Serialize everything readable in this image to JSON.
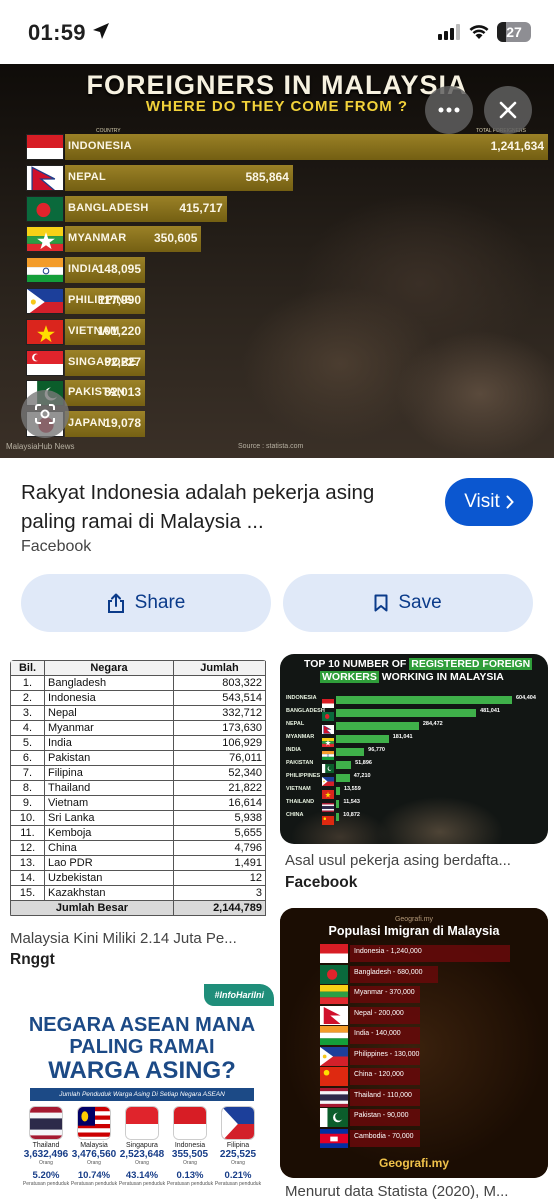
{
  "status_bar": {
    "time": "01:59",
    "battery": "27"
  },
  "hero": {
    "title": "FOREIGNERS IN MALAYSIA",
    "subtitle": "WHERE DO THEY COME FROM ?",
    "col_country": "COUNTRY",
    "col_total": "TOTAL FOREIGNERS",
    "footer": "MalaysiaHub News",
    "source": "Source : statista.com",
    "chart_data": {
      "type": "bar",
      "title": "FOREIGNERS IN MALAYSIA",
      "subtitle": "WHERE DO THEY COME FROM ?",
      "categories": [
        "INDONESIA",
        "NEPAL",
        "BANGLADESH",
        "MYANMAR",
        "INDIA",
        "PHILIPPINE",
        "VIETNAM",
        "SINGAPORE",
        "PAKISTAN",
        "JAPAN"
      ],
      "values": [
        1241634,
        585864,
        415717,
        350605,
        148095,
        117990,
        101220,
        92227,
        82013,
        19078
      ],
      "labels": [
        "1,241,634",
        "585,864",
        "415,717",
        "350,605",
        "148,095",
        "117,990",
        "101,220",
        "92,227",
        "82,013",
        "19,078"
      ],
      "orientation": "horizontal"
    }
  },
  "result": {
    "title": "Rakyat Indonesia adalah pekerja asing paling ramai di Malaysia ...",
    "source": "Facebook",
    "visit_label": "Visit",
    "share_label": "Share",
    "save_label": "Save"
  },
  "cards": {
    "table_card": {
      "headers": [
        "Bil.",
        "Negara",
        "Jumlah"
      ],
      "rows": [
        [
          "1.",
          "Bangladesh",
          "803,322"
        ],
        [
          "2.",
          "Indonesia",
          "543,514"
        ],
        [
          "3.",
          "Nepal",
          "332,712"
        ],
        [
          "4.",
          "Myanmar",
          "173,630"
        ],
        [
          "5.",
          "India",
          "106,929"
        ],
        [
          "6.",
          "Pakistan",
          "76,011"
        ],
        [
          "7.",
          "Filipina",
          "52,340"
        ],
        [
          "8.",
          "Thailand",
          "21,822"
        ],
        [
          "9.",
          "Vietnam",
          "16,614"
        ],
        [
          "10.",
          "Sri Lanka",
          "5,938"
        ],
        [
          "11.",
          "Kemboja",
          "5,655"
        ],
        [
          "12.",
          "China",
          "4,796"
        ],
        [
          "13.",
          "Lao PDR",
          "1,491"
        ],
        [
          "14.",
          "Uzbekistan",
          "12"
        ],
        [
          "15.",
          "Kazakhstan",
          "3"
        ]
      ],
      "total_label": "Jumlah Besar",
      "total_value": "2,144,789",
      "caption": "Malaysia Kini Miliki 2.14 Juta Pe...",
      "source": "Rnggt"
    },
    "top10_card": {
      "title_a": "TOP 10 NUMBER OF",
      "title_b": "REGISTERED FOREIGN",
      "title_c": "WORKERS",
      "title_d": "WORKING IN MALAYSIA",
      "chart_data": {
        "type": "bar",
        "categories": [
          "INDONESIA",
          "BANGLADESH",
          "NEPAL",
          "MYANMAR",
          "INDIA",
          "PAKISTAN",
          "PHILIPPINES",
          "VIETNAM",
          "THAILAND",
          "CHINA"
        ],
        "values": [
          604404,
          481041,
          284472,
          181041,
          96770,
          51896,
          47210,
          13559,
          11543,
          10872
        ],
        "labels": [
          "604,404",
          "481,041",
          "284,472",
          "181,041",
          "96,770",
          "51,896",
          "47,210",
          "13,559",
          "11,543",
          "10,872"
        ]
      },
      "caption": "Asal usul pekerja asing berdafta...",
      "source": "Facebook"
    },
    "asean_card": {
      "tag": "#InfoHariIni",
      "title_1": "NEGARA ASEAN MANA",
      "title_2": "PALING RAMAI",
      "title_3": "WARGA ASING?",
      "band": "Jumlah Penduduk Warga Asing Di Setiap Negara ASEAN",
      "countries": [
        {
          "name": "Thailand",
          "value": "3,632,496",
          "unit": "Orang",
          "pct": "5.20%",
          "pct_label": "Peratusan penduduk"
        },
        {
          "name": "Malaysia",
          "value": "3,476,560",
          "unit": "Orang",
          "pct": "10.74%",
          "pct_label": "Peratusan penduduk"
        },
        {
          "name": "Singapura",
          "value": "2,523,648",
          "unit": "Orang",
          "pct": "43.14%",
          "pct_label": "Peratusan penduduk"
        },
        {
          "name": "Indonesia",
          "value": "355,505",
          "unit": "Orang",
          "pct": "0.13%",
          "pct_label": "Peratusan penduduk"
        },
        {
          "name": "Filipina",
          "value": "225,525",
          "unit": "Orang",
          "pct": "0.21%",
          "pct_label": "Peratusan penduduk"
        }
      ]
    },
    "pop_card": {
      "brand_top": "Geografi.my",
      "title": "Populasi Imigran di Malaysia",
      "chart_data": {
        "type": "bar",
        "categories": [
          "Indonesia",
          "Bangladesh",
          "Myanmar",
          "Nepal",
          "India",
          "Philippines",
          "China",
          "Thailand",
          "Pakistan",
          "Cambodia"
        ],
        "values": [
          1240000,
          680000,
          370000,
          200000,
          140000,
          130000,
          120000,
          110000,
          90000,
          70000
        ],
        "labels": [
          "Indonesia - 1,240,000",
          "Bangladesh - 680,000",
          "Myanmar - 370,000",
          "Nepal - 200,000",
          "India - 140,000",
          "Philippines - 130,000",
          "China - 120,000",
          "Thailand - 110,000",
          "Pakistan - 90,000",
          "Cambodia - 70,000"
        ]
      },
      "brand": "Geografi.my",
      "caption": "Menurut data Statista (2020), M..."
    }
  }
}
